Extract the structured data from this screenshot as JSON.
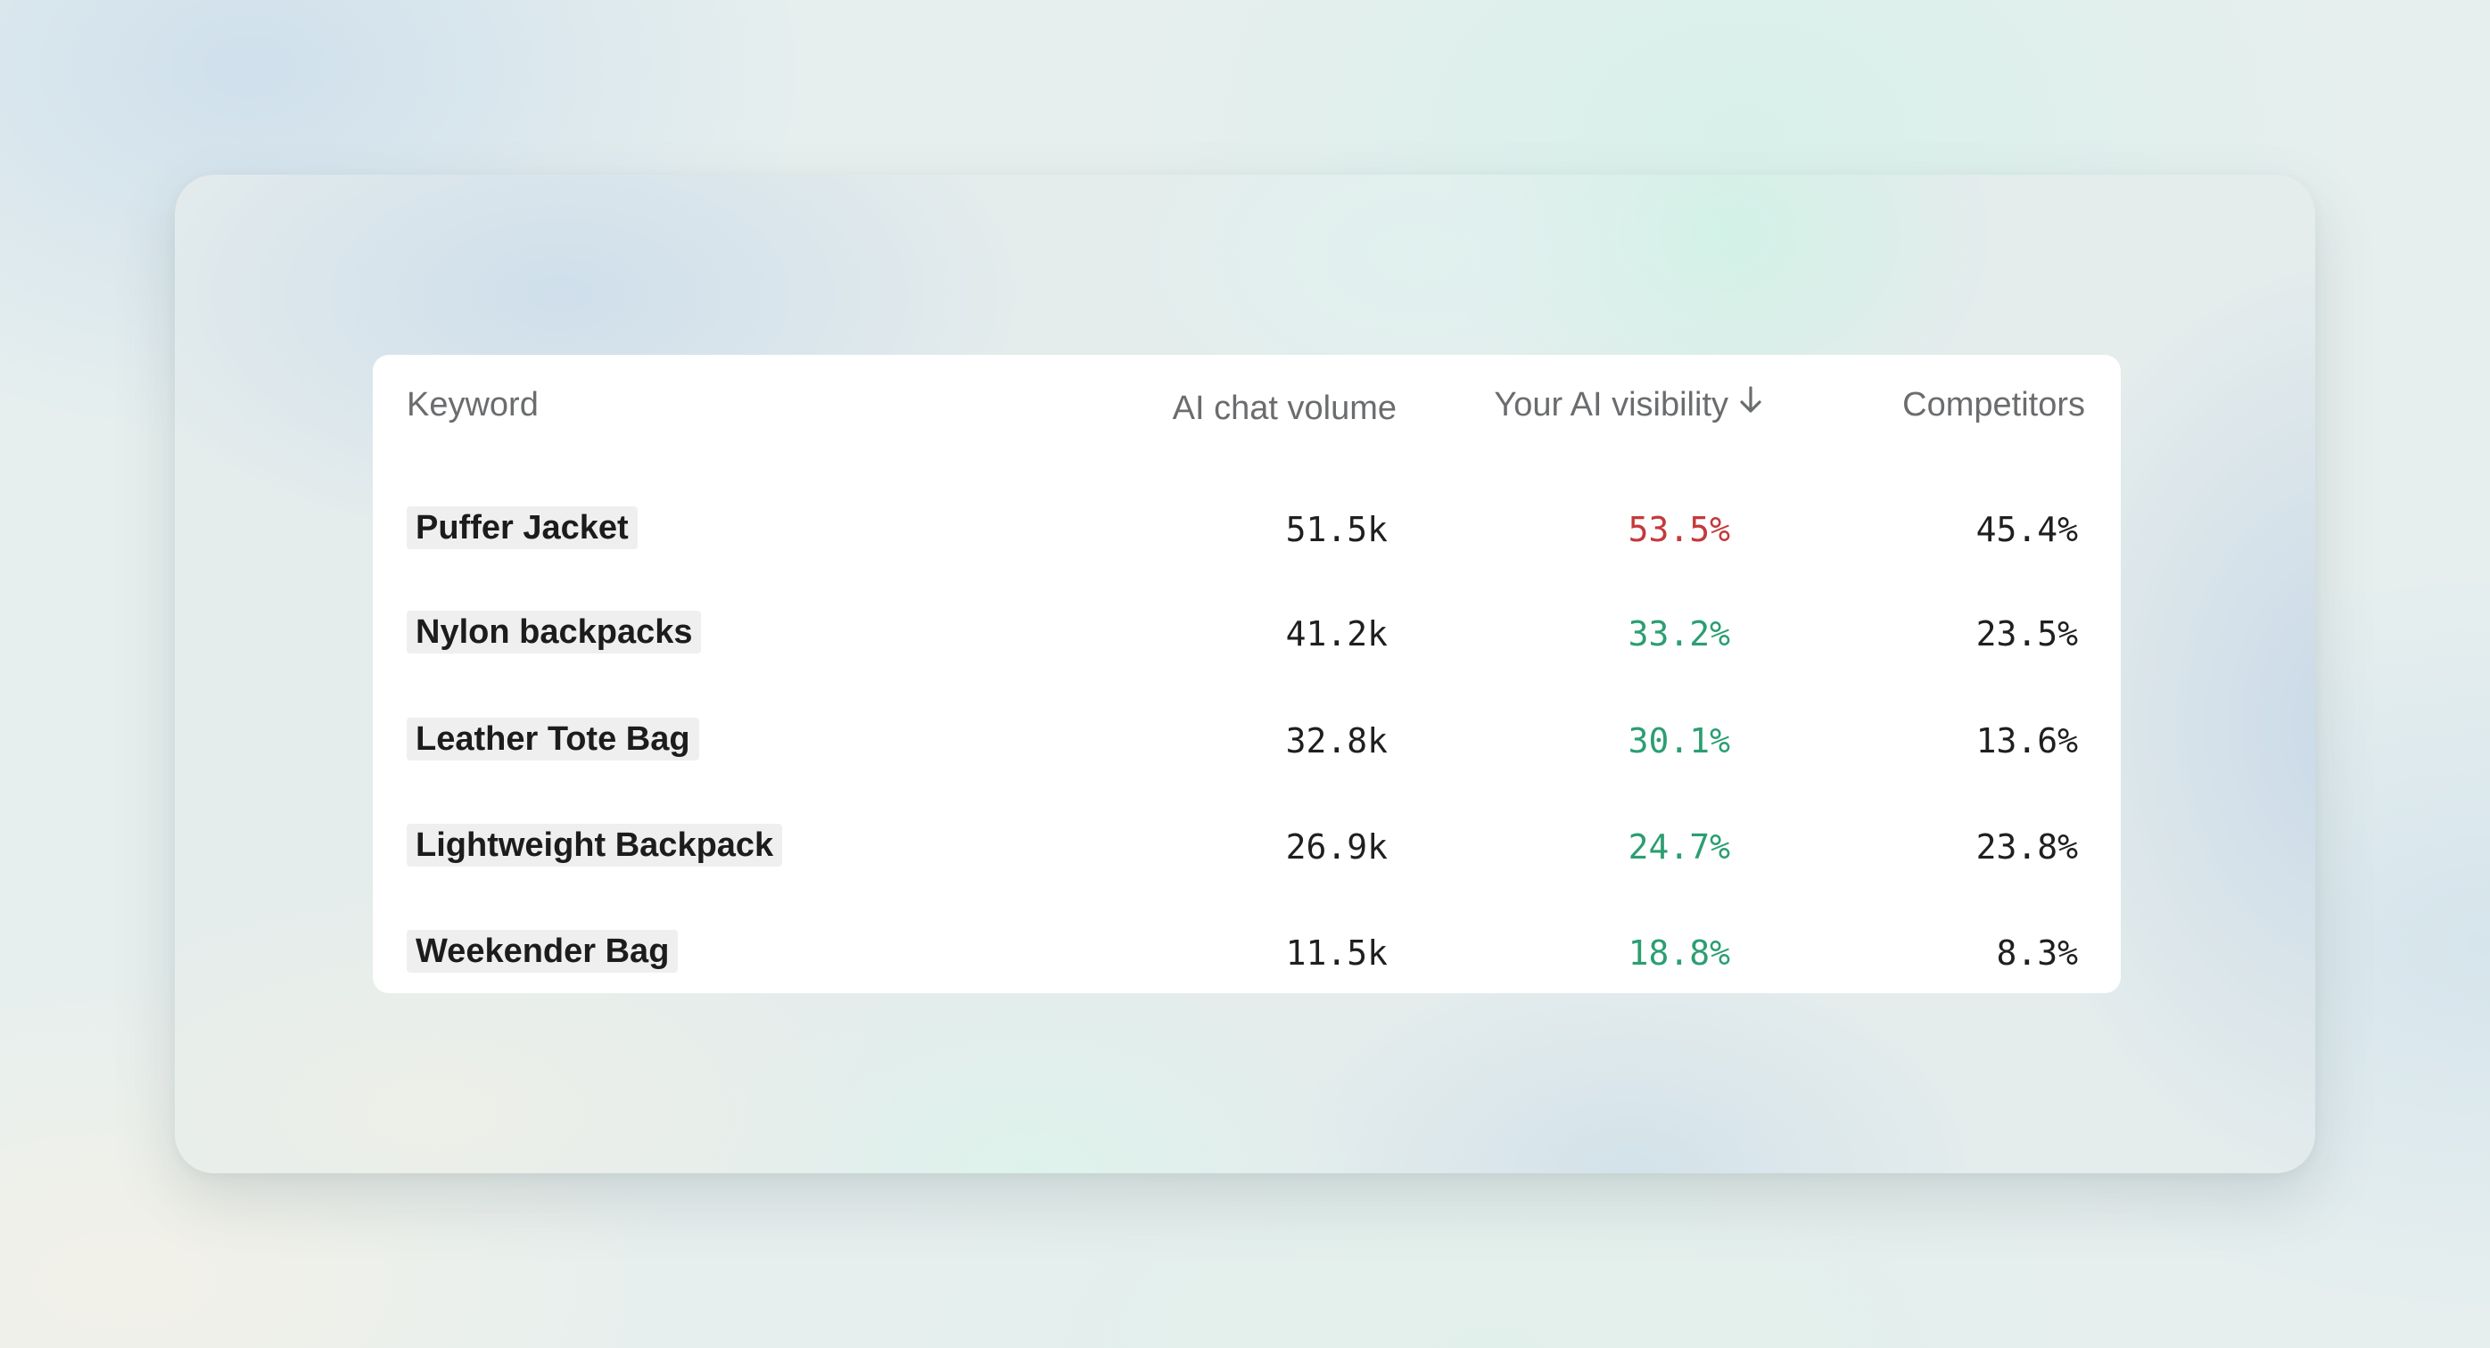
{
  "table": {
    "headers": {
      "keyword": "Keyword",
      "volume": "AI chat volume",
      "visibility": "Your AI visibility",
      "competitors": "Competitors"
    },
    "sort": {
      "column": "visibility",
      "direction": "descending",
      "icon": "arrow-down-icon"
    },
    "colors": {
      "negative": "#c5393b",
      "positive": "#2c9e72",
      "text": "#1f1f1f",
      "header": "#6a6c6e"
    },
    "rows": [
      {
        "keyword": "Puffer Jacket",
        "volume": "51.5k",
        "visibility": "53.5%",
        "visibility_status": "bad",
        "competitors": "45.4%"
      },
      {
        "keyword": "Nylon backpacks",
        "volume": "41.2k",
        "visibility": "33.2%",
        "visibility_status": "good",
        "competitors": "23.5%"
      },
      {
        "keyword": "Leather Tote Bag",
        "volume": "32.8k",
        "visibility": "30.1%",
        "visibility_status": "good",
        "competitors": "13.6%"
      },
      {
        "keyword": "Lightweight Backpack",
        "volume": "26.9k",
        "visibility": "24.7%",
        "visibility_status": "good",
        "competitors": "23.8%"
      },
      {
        "keyword": "Weekender Bag",
        "volume": "11.5k",
        "visibility": "18.8%",
        "visibility_status": "good",
        "competitors": "8.3%"
      }
    ]
  }
}
